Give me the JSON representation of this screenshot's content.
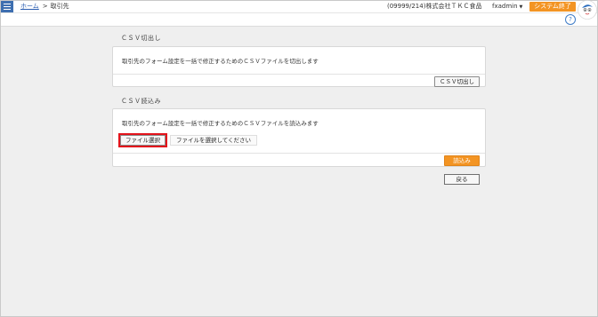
{
  "header": {
    "breadcrumb_home": "ホーム",
    "breadcrumb_sep": ">",
    "breadcrumb_current": "取引先",
    "company": "(09999/214)株式会社ＴＫＣ食品",
    "user": "fxadmin",
    "user_caret": "▼",
    "exit_label": "システム終了",
    "help_label": "?"
  },
  "export_section": {
    "title": "ＣＳＶ切出し",
    "description": "取引先のフォーム設定を一括で修正するためのＣＳＶファイルを切出します",
    "button_label": "ＣＳＶ切出し"
  },
  "import_section": {
    "title": "ＣＳＶ読込み",
    "description": "取引先のフォーム設定を一括で修正するためのＣＳＶファイルを読込みます",
    "file_button_label": "ファイル選択",
    "file_status": "ファイルを選択してください",
    "button_label": "読込み"
  },
  "back_label": "戻る",
  "colors": {
    "accent": "#f39423",
    "menu": "#3e6fb0",
    "highlight": "#e3131b",
    "link": "#2a5db0"
  },
  "icons": {
    "menu": "hamburger-icon",
    "help": "help-icon",
    "mascot": "mascot-icon",
    "caret": "caret-down-icon"
  }
}
